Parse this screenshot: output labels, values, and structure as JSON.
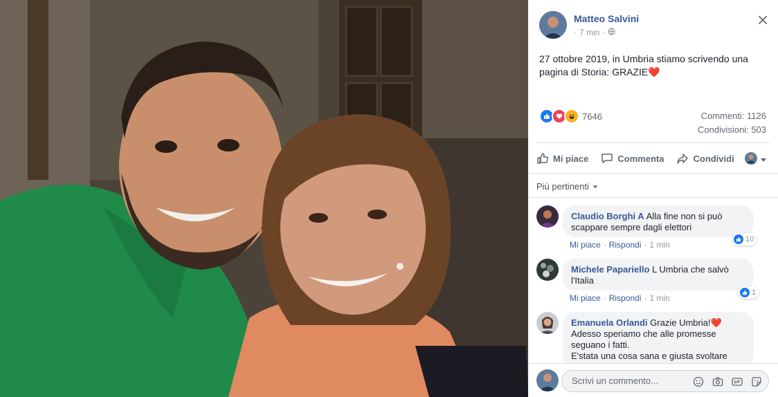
{
  "post": {
    "author": "Matteo Salvini",
    "time": "7 min",
    "text_main": "27 ottobre 2019, in Umbria stiamo scrivendo una pagina di Storia: GRAZIE",
    "text_emoji": "❤️"
  },
  "stats": {
    "reaction_count": "7646",
    "comments": "Commenti: 1126",
    "shares": "Condivisioni: 503"
  },
  "actions": {
    "like": "Mi piace",
    "comment": "Commenta",
    "share": "Condividi"
  },
  "sort_label": "Più pertinenti",
  "comments": [
    {
      "name": "Claudio Borghi A",
      "text": "Alla fine non si può scappare sempre dagli elettori",
      "like": "Mi piace",
      "reply": "Rispondi",
      "time": "1 min",
      "reactions": "10"
    },
    {
      "name": "Michele Papariello",
      "text": "L Umbria che salvò l'Italia",
      "like": "Mi piace",
      "reply": "Rispondi",
      "time": "1 min",
      "reactions": "1"
    },
    {
      "name": "Emanuela Orlandi",
      "text_line1": "Grazie Umbria!",
      "emoji": "❤️",
      "text_line2": "Adesso speriamo che alle promesse seguano i fatti.",
      "text_line3": "E'stata una cosa sana e giusta svoltare"
    }
  ],
  "composer": {
    "placeholder": "Scrivi un commento..."
  },
  "colors": {
    "link": "#385898",
    "like_blue": "#1877f2",
    "love_red": "#f33e58",
    "haha_yellow": "#f7b125"
  }
}
